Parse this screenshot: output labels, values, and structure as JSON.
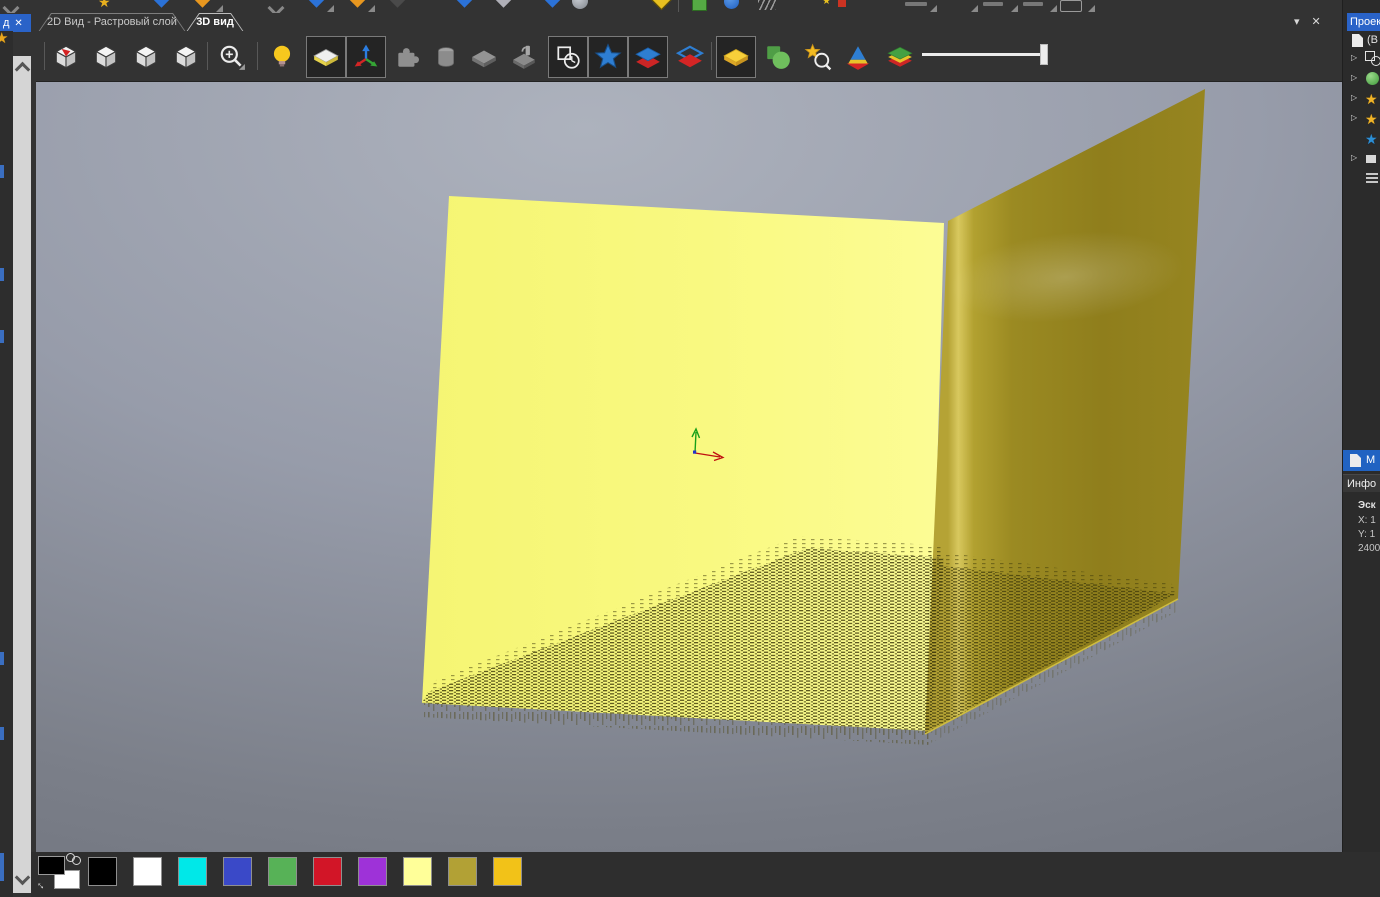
{
  "tab_bar": {
    "dock_label": "д",
    "dock_close_glyph": "✕",
    "tabs": [
      {
        "label": "2D Вид - Растровый слой",
        "active": false
      },
      {
        "label": "3D вид",
        "active": true
      }
    ],
    "collapse_glyph": "▾",
    "close_glyph": "✕",
    "overflow_glyph": "►"
  },
  "icons": {
    "star": "★"
  },
  "toolbar": {
    "buttons": [
      "rotate-view-cube",
      "view-cube-1",
      "view-cube-2",
      "view-cube-3",
      "zoom-window",
      "lighting",
      "show-plane",
      "show-axes",
      "plugins",
      "show-tool",
      "show-stock",
      "show-machined-stock",
      "show-contour",
      "show-features",
      "show-layers",
      "show-selected-layer",
      "show-model",
      "show-geometry",
      "find-object",
      "show-solid",
      "show-colored-layers"
    ],
    "pressed": [
      "show-plane",
      "show-axes",
      "show-contour",
      "show-features",
      "show-layers",
      "show-model"
    ],
    "disabled": [
      "plugins",
      "show-tool",
      "show-stock",
      "show-machined-stock"
    ],
    "slider": {
      "name": "transparency-slider",
      "value_fraction": 0.97
    }
  },
  "scene": {
    "left_plane_color": "#f8f87d",
    "right_plane_color": "#97861f",
    "axis_colors": {
      "x": "#c01010",
      "y": "#18a018",
      "z": "#2233cc"
    },
    "background_top": "#adb2bd",
    "background_bottom": "#6a6e78"
  },
  "project_panel": {
    "header": "Проек",
    "root_label": "(В",
    "expand_glyph": "▷",
    "rows": [
      {
        "icon": "circle-square-icon",
        "expandable": true
      },
      {
        "icon": "green-sphere-icon",
        "expandable": true
      },
      {
        "icon": "yellow-star-icon",
        "expandable": true
      },
      {
        "icon": "yellow-star-icon",
        "expandable": true
      },
      {
        "icon": "blue-star-icon",
        "expandable": false
      },
      {
        "icon": "white-layer-icon",
        "expandable": true
      },
      {
        "icon": "stack-icon",
        "expandable": false
      }
    ]
  },
  "info_panel": {
    "selected_label": "М",
    "header": "Инфо",
    "title": "Эск",
    "lines": [
      "X: 1",
      "Y: 1",
      "2400"
    ]
  },
  "palette": {
    "fg": "#000000",
    "bg": "#ffffff",
    "colors": [
      "#000000",
      "#ffffff",
      "#00e8e8",
      "#3a49c8",
      "#57b257",
      "#d21527",
      "#9e32d8",
      "#ffff99",
      "#b2a135",
      "#f2c218"
    ]
  }
}
